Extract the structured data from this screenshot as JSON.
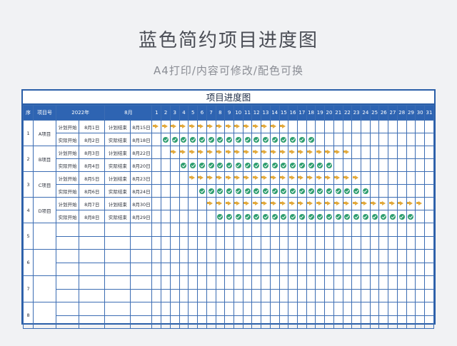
{
  "page": {
    "title": "蓝色简约项目进度图",
    "subtitle": "A4打印/内容可修改/配色可换"
  },
  "sheet": {
    "title": "项目进度图",
    "header": {
      "seq": "序",
      "project_no": "项目号",
      "year": "2022年",
      "month": "8月",
      "days": [
        "1",
        "2",
        "3",
        "4",
        "5",
        "6",
        "7",
        "8",
        "9",
        "10",
        "11",
        "12",
        "13",
        "14",
        "15",
        "16",
        "17",
        "18",
        "19",
        "20",
        "21",
        "22",
        "23",
        "24",
        "25",
        "26",
        "27",
        "28",
        "29",
        "30",
        "31"
      ]
    },
    "icons": {
      "planned": "arrow-right-icon",
      "actual": "check-circle-icon"
    },
    "colors": {
      "header": "#2e64b2",
      "planned": "#e2a93b",
      "actual": "#2f9e6f",
      "border": "#3c6db3"
    },
    "projects": [
      {
        "seq": "1",
        "name": "A项目",
        "rows": [
          {
            "kind": "plan",
            "start_label": "计划开始",
            "start_date": "8月1日",
            "end_label": "计划结束",
            "end_date": "8月15日",
            "from": 1,
            "to": 15
          },
          {
            "kind": "actual",
            "start_label": "实际开始",
            "start_date": "8月2日",
            "end_label": "实际结束",
            "end_date": "8月18日",
            "from": 2,
            "to": 18
          }
        ]
      },
      {
        "seq": "2",
        "name": "B项目",
        "rows": [
          {
            "kind": "plan",
            "start_label": "计划开始",
            "start_date": "8月3日",
            "end_label": "计划结束",
            "end_date": "8月22日",
            "from": 3,
            "to": 22
          },
          {
            "kind": "actual",
            "start_label": "实际开始",
            "start_date": "8月4日",
            "end_label": "实际结束",
            "end_date": "8月20日",
            "from": 4,
            "to": 20
          }
        ]
      },
      {
        "seq": "3",
        "name": "C项目",
        "rows": [
          {
            "kind": "plan",
            "start_label": "计划开始",
            "start_date": "8月5日",
            "end_label": "计划结束",
            "end_date": "8月23日",
            "from": 5,
            "to": 23
          },
          {
            "kind": "actual",
            "start_label": "实际开始",
            "start_date": "8月6日",
            "end_label": "实际结束",
            "end_date": "8月24日",
            "from": 6,
            "to": 24
          }
        ]
      },
      {
        "seq": "4",
        "name": "D项目",
        "rows": [
          {
            "kind": "plan",
            "start_label": "计划开始",
            "start_date": "8月7日",
            "end_label": "计划结束",
            "end_date": "8月30日",
            "from": 7,
            "to": 30
          },
          {
            "kind": "actual",
            "start_label": "实际开始",
            "start_date": "8月8日",
            "end_label": "实际结束",
            "end_date": "8月29日",
            "from": 8,
            "to": 29
          }
        ]
      },
      {
        "seq": "5",
        "name": "",
        "rows": []
      },
      {
        "seq": "6",
        "name": "",
        "rows": []
      },
      {
        "seq": "7",
        "name": "",
        "rows": []
      },
      {
        "seq": "8",
        "name": "",
        "rows": []
      }
    ]
  }
}
